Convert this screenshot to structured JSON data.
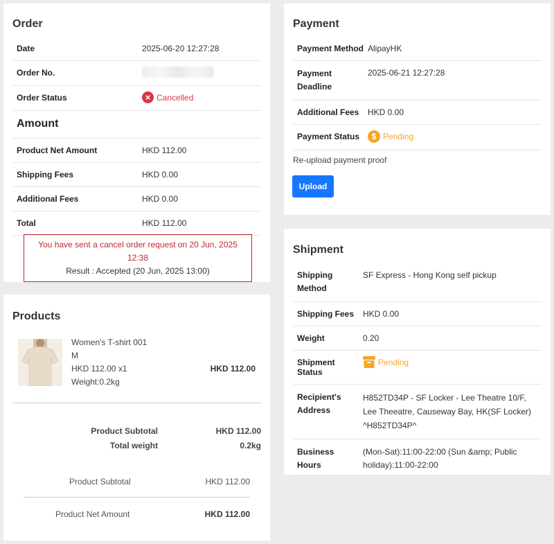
{
  "order": {
    "title": "Order",
    "date_label": "Date",
    "date_value": "2025-06-20 12:27:28",
    "order_no_label": "Order No.",
    "status_label": "Order Status",
    "status_value": "Cancelled",
    "status_icon": "x-circle-icon",
    "status_color": "#dc3545",
    "amount_title": "Amount",
    "net_label": "Product Net Amount",
    "net_value": "HKD 112.00",
    "shipping_label": "Shipping Fees",
    "shipping_value": "HKD 0.00",
    "additional_label": "Additional Fees",
    "additional_value": "HKD 0.00",
    "total_label": "Total",
    "total_value": "HKD 112.00",
    "notice_line1": "You have sent a cancel order request on 20 Jun, 2025 12:38",
    "notice_line2": "Result : Accepted (20 Jun, 2025 13:00)"
  },
  "payment": {
    "title": "Payment",
    "method_label": "Payment Method",
    "method_value": "AlipayHK",
    "deadline_label": "Payment Deadline",
    "deadline_value": "2025-06-21 12:27:28",
    "additional_label": "Additional Fees",
    "additional_value": "HKD 0.00",
    "status_label": "Payment Status",
    "status_value": "Pending",
    "status_icon": "dollar-coin-icon",
    "status_color": "#f5a623",
    "reupload_text": "Re-upload payment proof",
    "upload_label": "Upload"
  },
  "products": {
    "title": "Products",
    "item": {
      "name": "Women's T-shirt 001",
      "size": "M",
      "price_qty": "HKD 112.00 x1",
      "weight": "Weight:0.2kg",
      "line_total": "HKD 112.00"
    },
    "subtotal_label": "Product Subtotal",
    "subtotal_value": "HKD 112.00",
    "total_weight_label": "Total weight",
    "total_weight_value": "0.2kg",
    "summary_subtotal_label": "Product Subtotal",
    "summary_subtotal_value": "HKD 112.00",
    "summary_net_label": "Product Net Amount",
    "summary_net_value": "HKD 112.00"
  },
  "shipment": {
    "title": "Shipment",
    "method_label": "Shipping Method",
    "method_value": "SF Express - Hong Kong self pickup",
    "fees_label": "Shipping Fees",
    "fees_value": "HKD 0.00",
    "weight_label": "Weight",
    "weight_value": "0.20",
    "status_label": "Shipment Status",
    "status_value": "Pending",
    "status_icon": "box-icon",
    "status_color": "#f5a623",
    "address_label": "Recipient's Address",
    "address_value": "H852TD34P - SF Locker - Lee Theatre 10/F, Lee Theeatre, Causeway Bay, HK(SF Locker) ^H852TD34P^",
    "hours_label": "Business Hours",
    "hours_value": "(Mon-Sat):11:00-22:00 (Sun &amp; Public holiday):11:00-22:00"
  }
}
